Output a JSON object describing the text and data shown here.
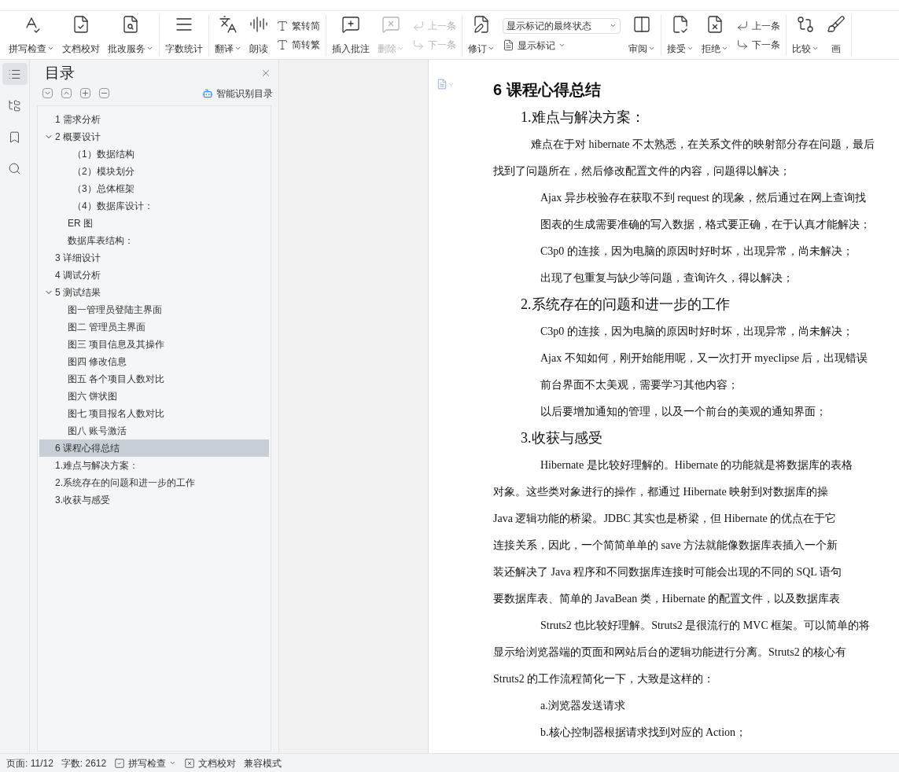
{
  "toolbar": {
    "groups": [
      {
        "items": [
          {
            "kind": "large",
            "label": "拼写检查",
            "dropdown": true,
            "disabled": false
          },
          {
            "kind": "large",
            "label": "文档校对",
            "dropdown": false,
            "disabled": false
          },
          {
            "kind": "large",
            "label": "批改服务",
            "dropdown": true,
            "disabled": false
          }
        ]
      },
      {
        "items": [
          {
            "kind": "large",
            "label": "字数统计",
            "dropdown": false,
            "disabled": false
          }
        ]
      },
      {
        "items": [
          {
            "kind": "large",
            "label": "翻译",
            "dropdown": true,
            "disabled": false
          },
          {
            "kind": "large",
            "label": "朗读",
            "dropdown": false,
            "disabled": false
          },
          {
            "kind": "pair",
            "top": {
              "label": "繁转简",
              "disabled": false
            },
            "bottom": {
              "label": "简转繁",
              "disabled": false
            }
          }
        ]
      },
      {
        "items": [
          {
            "kind": "large",
            "label": "插入批注",
            "dropdown": false,
            "disabled": false
          },
          {
            "kind": "large",
            "label": "删除",
            "dropdown": true,
            "disabled": true
          },
          {
            "kind": "pair",
            "top": {
              "label": "上一条",
              "disabled": true
            },
            "bottom": {
              "label": "下一条",
              "disabled": true
            }
          }
        ]
      },
      {
        "items": [
          {
            "kind": "large",
            "label": "修订",
            "dropdown": true,
            "disabled": false
          },
          {
            "kind": "select",
            "value": "显示标记的最终状态",
            "label": "显示标记"
          },
          {
            "kind": "large",
            "label": "审阅",
            "dropdown": true,
            "disabled": false
          }
        ]
      },
      {
        "items": [
          {
            "kind": "large",
            "label": "接受",
            "dropdown": true,
            "disabled": false
          },
          {
            "kind": "large",
            "label": "拒绝",
            "dropdown": true,
            "disabled": false
          },
          {
            "kind": "pair",
            "top": {
              "label": "上一条",
              "disabled": false
            },
            "bottom": {
              "label": "下一条",
              "disabled": false
            }
          }
        ]
      },
      {
        "items": [
          {
            "kind": "large",
            "label": "比较",
            "dropdown": true,
            "disabled": false
          },
          {
            "kind": "large",
            "label": "画",
            "dropdown": false,
            "disabled": false
          }
        ]
      }
    ]
  },
  "rail": [
    {
      "selected": true
    },
    {
      "selected": false
    },
    {
      "selected": false
    },
    {
      "selected": false
    }
  ],
  "toc": {
    "title": "目录",
    "smart_button": "智能识别目录",
    "items": [
      {
        "label": "1  需求分析",
        "selected": false
      },
      {
        "label": "2  概要设计",
        "selected": false,
        "expanded": true,
        "children": [
          {
            "label": "（1）数据结构",
            "selected": false,
            "kind": "sub"
          },
          {
            "label": "（2）模块划分",
            "selected": false,
            "kind": "sub"
          },
          {
            "label": "（3）总体框架",
            "selected": false,
            "kind": "sub"
          },
          {
            "label": "（4）数据库设计：",
            "selected": false,
            "kind": "sub"
          },
          {
            "label": "ER 图",
            "selected": false,
            "kind": "plain"
          },
          {
            "label": "数据库表结构：",
            "selected": false,
            "kind": "plain"
          }
        ]
      },
      {
        "label": "3  详细设计",
        "selected": false
      },
      {
        "label": "4  调试分析",
        "selected": false
      },
      {
        "label": "5    测试结果",
        "selected": false,
        "expanded": true,
        "children": [
          {
            "label": "图一管理员登陆主界面",
            "selected": false,
            "kind": "plain"
          },
          {
            "label": "图二  管理员主界面",
            "selected": false,
            "kind": "plain"
          },
          {
            "label": "图三  项目信息及其操作",
            "selected": false,
            "kind": "plain"
          },
          {
            "label": "图四  修改信息",
            "selected": false,
            "kind": "plain"
          },
          {
            "label": "图五  各个项目人数对比",
            "selected": false,
            "kind": "plain"
          },
          {
            "label": "图六  饼状图",
            "selected": false,
            "kind": "plain"
          },
          {
            "label": "图七  项目报名人数对比",
            "selected": false,
            "kind": "plain"
          },
          {
            "label": "图八  账号激活",
            "selected": false,
            "kind": "plain"
          }
        ]
      },
      {
        "label": "6  课程心得总结",
        "selected": true
      },
      {
        "label": "1.难点与解决方案：",
        "selected": false
      },
      {
        "label": "2.系统存在的问题和进一步的工作",
        "selected": false
      },
      {
        "label": "3.收获与感受",
        "selected": false
      }
    ]
  },
  "document": {
    "lines": [
      {
        "kind": "h1",
        "text": "6  课程心得总结"
      },
      {
        "kind": "h2",
        "text": "1.难点与解决方案："
      },
      {
        "kind": "first",
        "text": "难点在于对 hibernate 不太熟悉，在关系文件的映射部分存在问题，最后"
      },
      {
        "kind": "plain",
        "text": "找到了问题所在，然后修改配置文件的内容，问题得以解决；"
      },
      {
        "kind": "indent",
        "text": "Ajax 异步校验存在获取不到 request 的现象，然后通过在网上查询找"
      },
      {
        "kind": "indent",
        "text": "图表的生成需要准确的写入数据，格式要正确，在于认真才能解决；"
      },
      {
        "kind": "indent",
        "text": "C3p0 的连接，因为电脑的原因时好时坏，出现异常，尚未解决；"
      },
      {
        "kind": "indent",
        "text": "出现了包重复与缺少等问题，查询许久，得以解决；"
      },
      {
        "kind": "h2",
        "text": "2.系统存在的问题和进一步的工作"
      },
      {
        "kind": "indent",
        "text": "C3p0 的连接，因为电脑的原因时好时坏，出现异常，尚未解决；"
      },
      {
        "kind": "indent",
        "text": "Ajax 不知如何，刚开始能用呢，又一次打开 myeclipse 后，出现错误"
      },
      {
        "kind": "indent",
        "text": "前台界面不太美观，需要学习其他内容；"
      },
      {
        "kind": "indent",
        "text": "以后要增加通知的管理，以及一个前台的美观的通知界面；"
      },
      {
        "kind": "h2",
        "text": "3.收获与感受"
      },
      {
        "kind": "indent",
        "text": "Hibernate 是比较好理解的。Hibernate 的功能就是将数据库的表格"
      },
      {
        "kind": "plain",
        "text": "对象。这些类对象进行的操作，都通过 Hibernate 映射到对数据库的操"
      },
      {
        "kind": "plain",
        "text": "Java 逻辑功能的桥梁。JDBC 其实也是桥梁，但 Hibernate 的优点在于它"
      },
      {
        "kind": "plain",
        "text": "连接关系，因此，一个简简单单的 save 方法就能像数据库表插入一个新"
      },
      {
        "kind": "plain",
        "text": "装还解决了 Java 程序和不同数据库连接时可能会出现的不同的 SQL 语句"
      },
      {
        "kind": "plain",
        "text": "要数据库表、简单的 JavaBean 类，Hibernate 的配置文件，以及数据库表"
      },
      {
        "kind": "indent",
        "text": "Struts2 也比较好理解。Struts2 是很流行的 MVC 框架。可以简单的将"
      },
      {
        "kind": "plain",
        "text": "显示给浏览器端的页面和网站后台的逻辑功能进行分离。Struts2 的核心有"
      },
      {
        "kind": "plain",
        "text": "Struts2 的工作流程简化一下，大致是这样的："
      },
      {
        "kind": "indent",
        "text": "a.浏览器发送请求"
      },
      {
        "kind": "indent",
        "text": "b.核心控制器根据请求找到对应的 Action；"
      }
    ]
  },
  "status_bar": {
    "page": "页面: 11/12",
    "words": "字数: 2612",
    "spell": "拼写检查",
    "proof": "文档校对",
    "mode": "兼容模式"
  }
}
